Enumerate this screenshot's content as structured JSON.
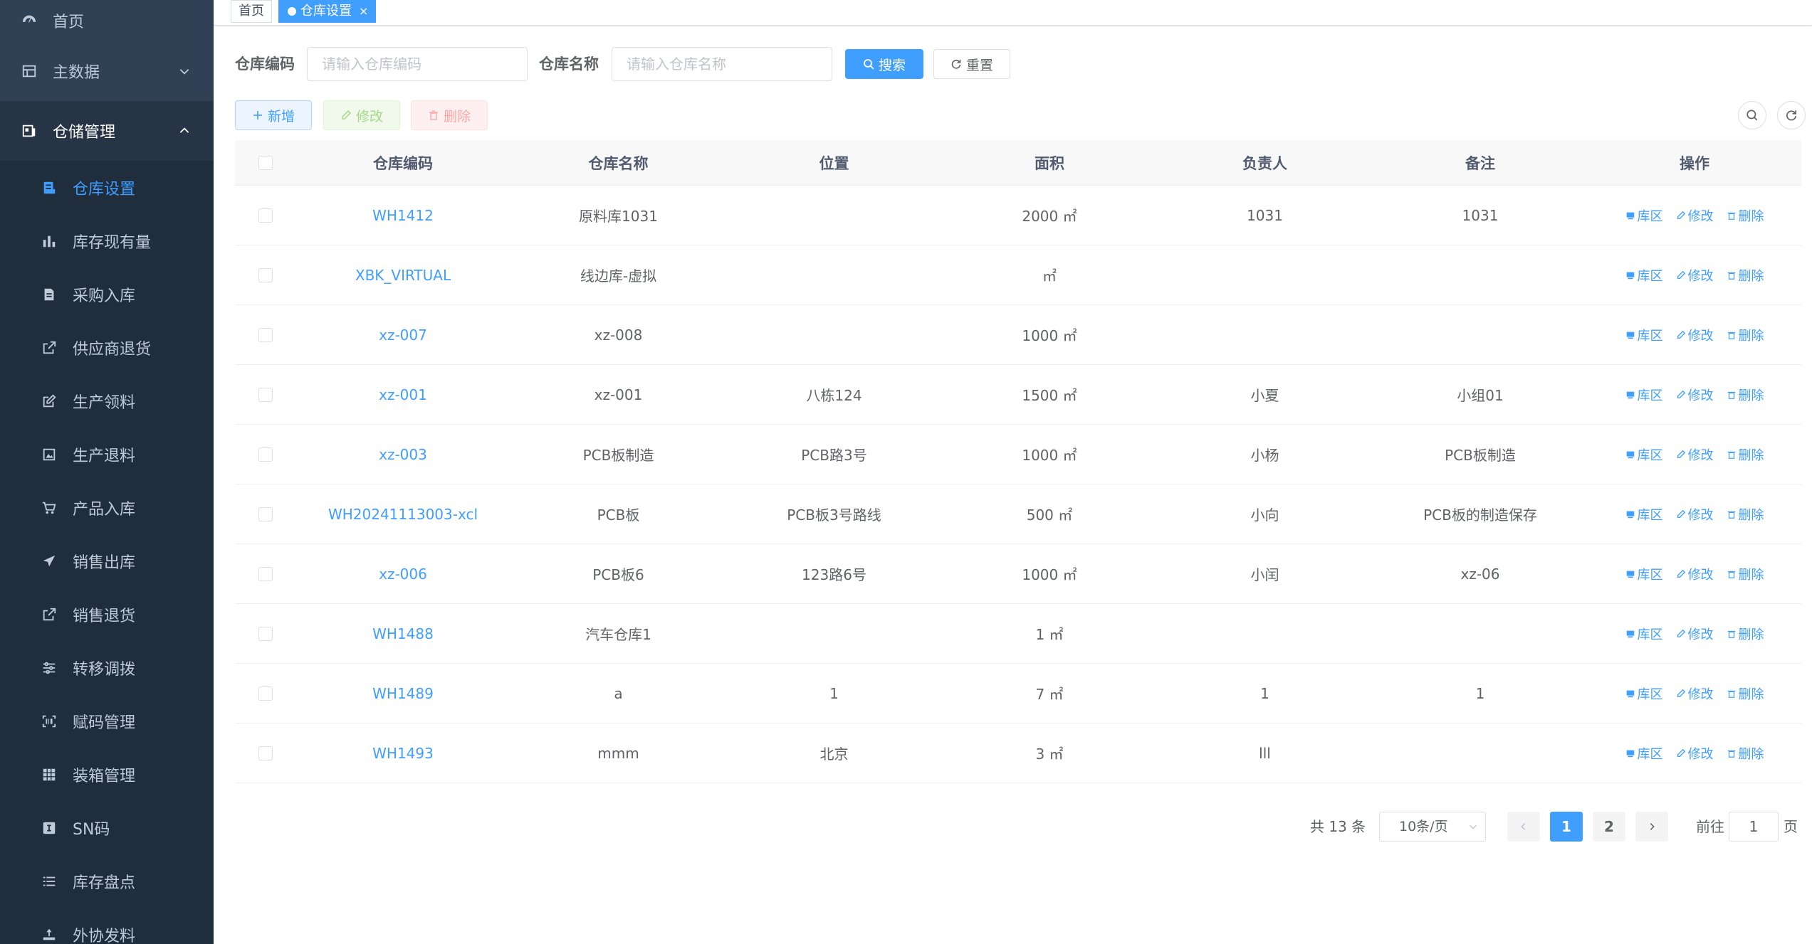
{
  "sidebar": {
    "home": {
      "label": "首页",
      "icon": "dashboard-icon"
    },
    "master_data": {
      "label": "主数据",
      "icon": "table-icon"
    },
    "storage": {
      "label": "仓储管理",
      "icon": "storage-icon"
    },
    "items": [
      {
        "label": "仓库设置",
        "icon": "warehouse-icon",
        "active": true
      },
      {
        "label": "库存现有量",
        "icon": "bar-chart-icon"
      },
      {
        "label": "采购入库",
        "icon": "document-icon"
      },
      {
        "label": "供应商退货",
        "icon": "external-link-icon"
      },
      {
        "label": "生产领料",
        "icon": "edit-icon"
      },
      {
        "label": "生产退料",
        "icon": "picture-icon"
      },
      {
        "label": "产品入库",
        "icon": "cart-icon"
      },
      {
        "label": "销售出库",
        "icon": "send-icon"
      },
      {
        "label": "销售退货",
        "icon": "external-link-icon"
      },
      {
        "label": "转移调拨",
        "icon": "sliders-icon"
      },
      {
        "label": "赋码管理",
        "icon": "barcode-icon"
      },
      {
        "label": "装箱管理",
        "icon": "grid-icon"
      },
      {
        "label": "SN码",
        "icon": "sn-icon"
      },
      {
        "label": "库存盘点",
        "icon": "list-icon"
      },
      {
        "label": "外协发料",
        "icon": "outsource-icon"
      }
    ]
  },
  "tags": {
    "home": "首页",
    "current": "仓库设置",
    "close": "×"
  },
  "search": {
    "code_label": "仓库编码",
    "code_placeholder": "请输入仓库编码",
    "name_label": "仓库名称",
    "name_placeholder": "请输入仓库名称",
    "search_button": "搜索",
    "reset_button": "重置"
  },
  "toolbar": {
    "add": "新增",
    "edit": "修改",
    "delete": "删除"
  },
  "table": {
    "columns": [
      "仓库编码",
      "仓库名称",
      "位置",
      "面积",
      "负责人",
      "备注",
      "操作"
    ],
    "actions": {
      "area": "库区",
      "edit": "修改",
      "delete": "删除"
    },
    "rows": [
      {
        "code": "WH1412",
        "name": "原料库1031",
        "location": "",
        "area": "2000 ㎡",
        "owner": "1031",
        "remark": "1031"
      },
      {
        "code": "XBK_VIRTUAL",
        "name": "线边库-虚拟",
        "location": "",
        "area": "㎡",
        "owner": "",
        "remark": ""
      },
      {
        "code": "xz-007",
        "name": "xz-008",
        "location": "",
        "area": "1000 ㎡",
        "owner": "",
        "remark": ""
      },
      {
        "code": "xz-001",
        "name": "xz-001",
        "location": "八栋124",
        "area": "1500 ㎡",
        "owner": "小夏",
        "remark": "小组01"
      },
      {
        "code": "xz-003",
        "name": "PCB板制造",
        "location": "PCB路3号",
        "area": "1000 ㎡",
        "owner": "小杨",
        "remark": "PCB板制造"
      },
      {
        "code": "WH20241113003-xcl",
        "name": "PCB板",
        "location": "PCB板3号路线",
        "area": "500 ㎡",
        "owner": "小向",
        "remark": "PCB板的制造保存"
      },
      {
        "code": "xz-006",
        "name": "PCB板6",
        "location": "123路6号",
        "area": "1000 ㎡",
        "owner": "小闰",
        "remark": "xz-06"
      },
      {
        "code": "WH1488",
        "name": "汽车仓库1",
        "location": "",
        "area": "1 ㎡",
        "owner": "",
        "remark": ""
      },
      {
        "code": "WH1489",
        "name": "a",
        "location": "1",
        "area": "7 ㎡",
        "owner": "1",
        "remark": "1"
      },
      {
        "code": "WH1493",
        "name": "mmm",
        "location": "北京",
        "area": "3 ㎡",
        "owner": "lll",
        "remark": ""
      }
    ]
  },
  "pagination": {
    "total": "共 13 条",
    "page_size": "10条/页",
    "pages": [
      "1",
      "2"
    ],
    "current": "1",
    "goto_label": "前往",
    "goto_value": "1",
    "page_suffix": "页"
  },
  "colors": {
    "sidebar_bg": "#304156",
    "submenu_bg": "#1f2d3d",
    "accent": "#409eff"
  }
}
